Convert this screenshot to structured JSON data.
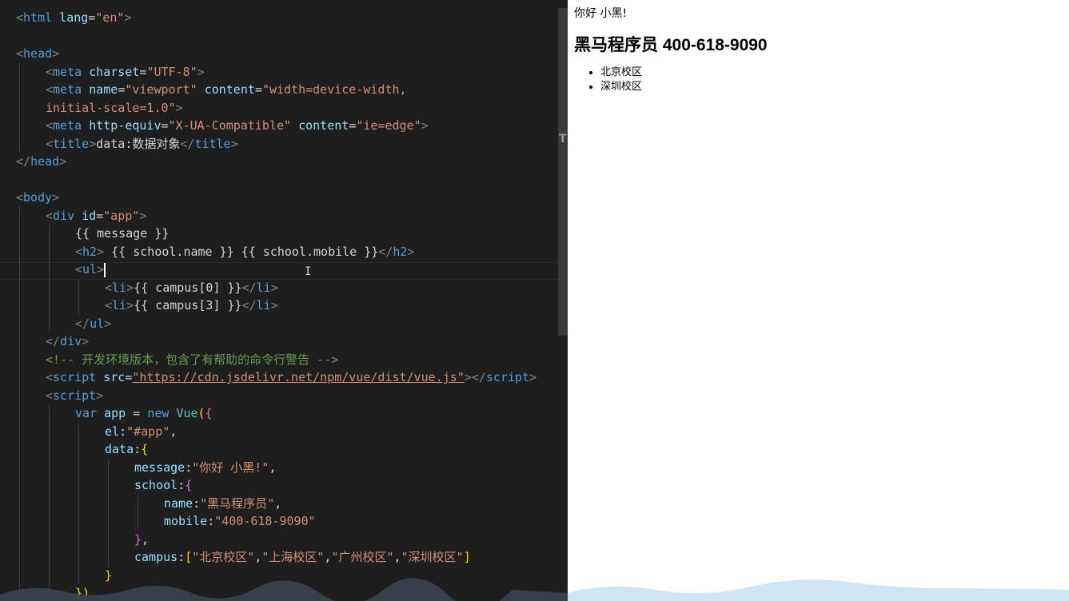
{
  "editor": {
    "lines": [
      {
        "indent": 0,
        "parts": [
          [
            "ang",
            "<"
          ],
          [
            "tag",
            "html"
          ],
          [
            "",
            " "
          ],
          [
            "attr",
            "lang"
          ],
          [
            "",
            "="
          ],
          [
            "str",
            "\"en\""
          ],
          [
            "ang",
            ">"
          ]
        ]
      },
      {
        "indent": 0,
        "parts": []
      },
      {
        "indent": 0,
        "parts": [
          [
            "ang",
            "<"
          ],
          [
            "tag",
            "head"
          ],
          [
            "ang",
            ">"
          ]
        ]
      },
      {
        "indent": 1,
        "parts": [
          [
            "ang",
            "<"
          ],
          [
            "tag",
            "meta"
          ],
          [
            "",
            " "
          ],
          [
            "attr",
            "charset"
          ],
          [
            "",
            "="
          ],
          [
            "str",
            "\"UTF-8\""
          ],
          [
            "ang",
            ">"
          ]
        ]
      },
      {
        "indent": 1,
        "parts": [
          [
            "ang",
            "<"
          ],
          [
            "tag",
            "meta"
          ],
          [
            "",
            " "
          ],
          [
            "attr",
            "name"
          ],
          [
            "",
            "="
          ],
          [
            "str",
            "\"viewport\""
          ],
          [
            "",
            " "
          ],
          [
            "attr",
            "content"
          ],
          [
            "",
            "="
          ],
          [
            "str",
            "\"width=device-width,"
          ]
        ]
      },
      {
        "indent": 1,
        "parts": [
          [
            "str",
            "initial-scale=1.0\""
          ],
          [
            "ang",
            ">"
          ]
        ]
      },
      {
        "indent": 1,
        "parts": [
          [
            "ang",
            "<"
          ],
          [
            "tag",
            "meta"
          ],
          [
            "",
            " "
          ],
          [
            "attr",
            "http-equiv"
          ],
          [
            "",
            "="
          ],
          [
            "str",
            "\"X-UA-Compatible\""
          ],
          [
            "",
            " "
          ],
          [
            "attr",
            "content"
          ],
          [
            "",
            "="
          ],
          [
            "str",
            "\"ie=edge\""
          ],
          [
            "ang",
            ">"
          ]
        ]
      },
      {
        "indent": 1,
        "parts": [
          [
            "ang",
            "<"
          ],
          [
            "tag",
            "title"
          ],
          [
            "ang",
            ">"
          ],
          [
            "",
            "data:数据对象"
          ],
          [
            "ang",
            "</"
          ],
          [
            "tag",
            "title"
          ],
          [
            "ang",
            ">"
          ]
        ]
      },
      {
        "indent": 0,
        "parts": [
          [
            "ang",
            "</"
          ],
          [
            "tag",
            "head"
          ],
          [
            "ang",
            ">"
          ]
        ]
      },
      {
        "indent": 0,
        "parts": []
      },
      {
        "indent": 0,
        "parts": [
          [
            "ang",
            "<"
          ],
          [
            "tag",
            "body"
          ],
          [
            "ang",
            ">"
          ]
        ]
      },
      {
        "indent": 1,
        "parts": [
          [
            "ang",
            "<"
          ],
          [
            "tag",
            "div"
          ],
          [
            "",
            " "
          ],
          [
            "attr",
            "id"
          ],
          [
            "",
            "="
          ],
          [
            "str",
            "\"app\""
          ],
          [
            "ang",
            ">"
          ]
        ]
      },
      {
        "indent": 2,
        "parts": [
          [
            "",
            "{{ message }}"
          ]
        ]
      },
      {
        "indent": 2,
        "parts": [
          [
            "ang",
            "<"
          ],
          [
            "tag",
            "h2"
          ],
          [
            "ang",
            ">"
          ],
          [
            "",
            " {{ school.name }} {{ school.mobile }}"
          ],
          [
            "ang",
            "</"
          ],
          [
            "tag",
            "h2"
          ],
          [
            "ang",
            ">"
          ]
        ]
      },
      {
        "indent": 2,
        "parts": [
          [
            "ang",
            "<"
          ],
          [
            "tag",
            "ul"
          ],
          [
            "ang",
            ">"
          ],
          [
            "caret",
            ""
          ]
        ]
      },
      {
        "indent": 3,
        "parts": [
          [
            "ang",
            "<"
          ],
          [
            "tag",
            "li"
          ],
          [
            "ang",
            ">"
          ],
          [
            "",
            "{{ campus[0] }}"
          ],
          [
            "ang",
            "</"
          ],
          [
            "tag",
            "li"
          ],
          [
            "ang",
            ">"
          ]
        ]
      },
      {
        "indent": 3,
        "parts": [
          [
            "ang",
            "<"
          ],
          [
            "tag",
            "li"
          ],
          [
            "ang",
            ">"
          ],
          [
            "",
            "{{ campus[3] }}"
          ],
          [
            "ang",
            "</"
          ],
          [
            "tag",
            "li"
          ],
          [
            "ang",
            ">"
          ]
        ]
      },
      {
        "indent": 2,
        "parts": [
          [
            "ang",
            "</"
          ],
          [
            "tag",
            "ul"
          ],
          [
            "ang",
            ">"
          ]
        ]
      },
      {
        "indent": 1,
        "parts": [
          [
            "ang",
            "</"
          ],
          [
            "tag",
            "div"
          ],
          [
            "ang",
            ">"
          ]
        ]
      },
      {
        "indent": 1,
        "parts": [
          [
            "com",
            "<!-- 开发环境版本，包含了有帮助的命令行警告 -->"
          ]
        ]
      },
      {
        "indent": 1,
        "parts": [
          [
            "ang",
            "<"
          ],
          [
            "tag",
            "script"
          ],
          [
            "",
            " "
          ],
          [
            "attr",
            "src"
          ],
          [
            "",
            "="
          ],
          [
            "url",
            "\"https://cdn.jsdelivr.net/npm/vue/dist/vue.js\""
          ],
          [
            "ang",
            "></"
          ],
          [
            "tag",
            "script"
          ],
          [
            "ang",
            ">"
          ]
        ]
      },
      {
        "indent": 1,
        "parts": [
          [
            "ang",
            "<"
          ],
          [
            "tag",
            "script"
          ],
          [
            "ang",
            ">"
          ]
        ]
      },
      {
        "indent": 2,
        "parts": [
          [
            "kw",
            "var"
          ],
          [
            "",
            " "
          ],
          [
            "prop",
            "app"
          ],
          [
            "",
            " = "
          ],
          [
            "kw",
            "new"
          ],
          [
            "",
            " "
          ],
          [
            "cls",
            "Vue"
          ],
          [
            "brk",
            "("
          ],
          [
            "brk2",
            "{"
          ]
        ]
      },
      {
        "indent": 3,
        "parts": [
          [
            "prop",
            "el"
          ],
          [
            "",
            ":"
          ],
          [
            "str",
            "\"#app\""
          ],
          [
            "",
            ","
          ]
        ]
      },
      {
        "indent": 3,
        "parts": [
          [
            "prop",
            "data"
          ],
          [
            "",
            ":"
          ],
          [
            "brk",
            "{"
          ]
        ]
      },
      {
        "indent": 4,
        "parts": [
          [
            "prop",
            "message"
          ],
          [
            "",
            ":"
          ],
          [
            "str",
            "\"你好 小黑!\""
          ],
          [
            "",
            ","
          ]
        ]
      },
      {
        "indent": 4,
        "parts": [
          [
            "prop",
            "school"
          ],
          [
            "",
            ":"
          ],
          [
            "brk2",
            "{"
          ]
        ]
      },
      {
        "indent": 5,
        "parts": [
          [
            "prop",
            "name"
          ],
          [
            "",
            ":"
          ],
          [
            "str",
            "\"黑马程序员\""
          ],
          [
            "",
            ","
          ]
        ]
      },
      {
        "indent": 5,
        "parts": [
          [
            "prop",
            "mobile"
          ],
          [
            "",
            ":"
          ],
          [
            "str",
            "\"400-618-9090\""
          ]
        ]
      },
      {
        "indent": 4,
        "parts": [
          [
            "brk2",
            "}"
          ],
          [
            "",
            ","
          ]
        ]
      },
      {
        "indent": 4,
        "parts": [
          [
            "prop",
            "campus"
          ],
          [
            "",
            ":"
          ],
          [
            "brk",
            "["
          ],
          [
            "str",
            "\"北京校区\""
          ],
          [
            "",
            ","
          ],
          [
            "str",
            "\"上海校区\""
          ],
          [
            "",
            ","
          ],
          [
            "str",
            "\"广州校区\""
          ],
          [
            "",
            ","
          ],
          [
            "str",
            "\"深圳校区\""
          ],
          [
            "brk",
            "]"
          ]
        ]
      },
      {
        "indent": 3,
        "parts": [
          [
            "brk",
            "}"
          ]
        ]
      },
      {
        "indent": 2,
        "parts": [
          [
            "brk",
            "})"
          ]
        ]
      }
    ]
  },
  "preview": {
    "message": "你好 小黑!",
    "heading": "黑马程序员 400-618-9090",
    "campus_items": [
      "北京校区",
      "深圳校区"
    ]
  },
  "side_letter": "T"
}
